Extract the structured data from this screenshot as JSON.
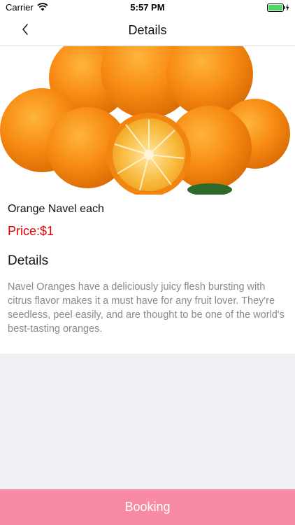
{
  "status_bar": {
    "carrier": "Carrier",
    "time": "5:57 PM",
    "wifi_icon": "wifi-icon",
    "battery_icon": "battery-charging-icon",
    "battery_color": "#4cd964"
  },
  "nav": {
    "title": "Details",
    "back_icon": "chevron-left-icon"
  },
  "product": {
    "image": "oranges-photo",
    "name": "Orange Navel each",
    "price": "Price:$1",
    "price_color": "#e10000"
  },
  "details": {
    "heading": "Details",
    "body": "Navel Oranges have a deliciously juicy flesh bursting with citrus flavor makes it a must have for any fruit lover. They're seedless, peel easily, and are thought to be one of the world's best-tasting oranges."
  },
  "footer": {
    "booking_label": "Booking",
    "booking_color": "#f98aa6"
  }
}
